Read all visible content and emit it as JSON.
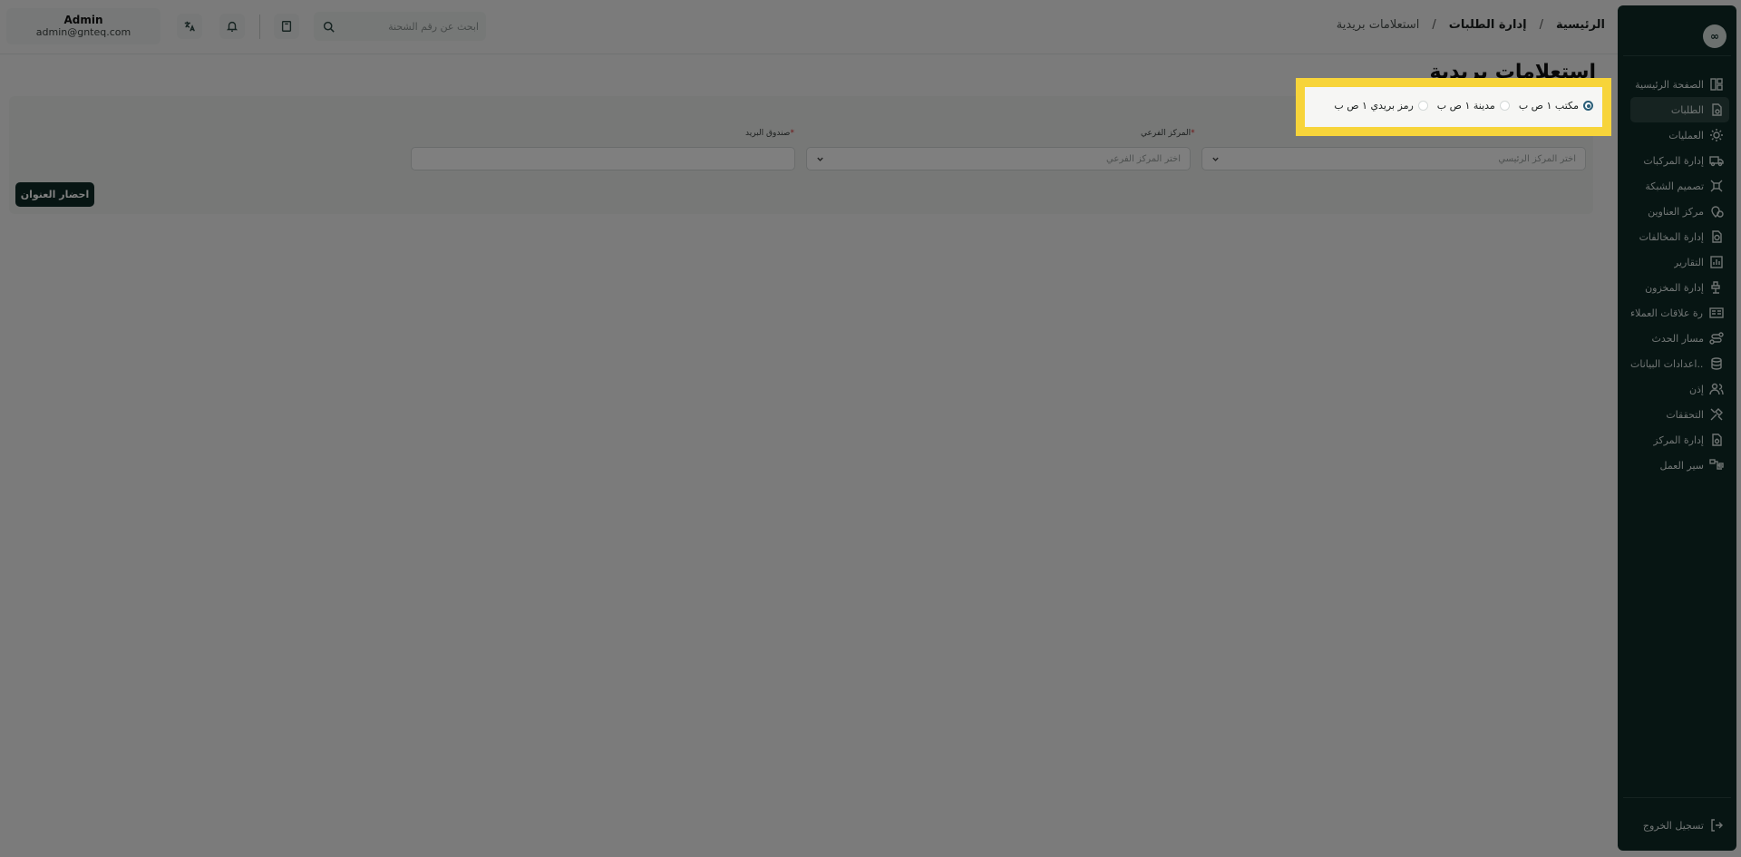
{
  "header": {
    "breadcrumb": [
      "الرئيسية",
      "إدارة الطلبات",
      "استعلامات بريدية"
    ],
    "search_placeholder": "ابحث عن رقم الشحنة",
    "user_name": "Admin",
    "user_email": "admin@gnteq.com"
  },
  "sidebar": {
    "items": [
      {
        "label": "الصفحة الرئيسية",
        "icon": "dashboard-icon"
      },
      {
        "label": "الطلبات",
        "icon": "orders-icon"
      },
      {
        "label": "العمليات",
        "icon": "operations-icon"
      },
      {
        "label": "إدارة المركبات",
        "icon": "truck-icon"
      },
      {
        "label": "تصميم الشبكة",
        "icon": "network-icon"
      },
      {
        "label": "مركز العناوين",
        "icon": "location-icon"
      },
      {
        "label": "إدارة المخالفات",
        "icon": "violation-icon"
      },
      {
        "label": "التقارير",
        "icon": "reports-icon"
      },
      {
        "label": "إدارة المخزون",
        "icon": "inventory-icon"
      },
      {
        "label": "إدارة علاقات العملاء",
        "icon": "crm-icon"
      },
      {
        "label": "مسار الحدث",
        "icon": "route-icon"
      },
      {
        "label": "اعدادات البيانات...",
        "icon": "database-icon"
      },
      {
        "label": "إذن",
        "icon": "users-icon"
      },
      {
        "label": "التحققات",
        "icon": "tools-icon"
      },
      {
        "label": "إدارة المركز",
        "icon": "center-icon"
      },
      {
        "label": "سير العمل",
        "icon": "workflow-icon"
      }
    ],
    "logout_label": "تسجيل الخروج"
  },
  "main": {
    "title": "استعلامات بريدية",
    "radio_options": [
      {
        "label": "مكتب ١ ص ب",
        "selected": true
      },
      {
        "label": "مدينة ١ ص ب",
        "selected": false
      },
      {
        "label": "رمز بريدي ١ ص ب",
        "selected": false
      }
    ],
    "fields": {
      "main_center_placeholder": "اختر المركز الرئيسي",
      "sub_center_label": "المركز الفرعي",
      "sub_center_placeholder": "اختر المركز الفرعي",
      "po_box_label": "صندوق البريد"
    },
    "fetch_button": "احضار العنوان"
  },
  "colors": {
    "sidebar_bg": "#0e2a27",
    "highlight": "#f7d43a",
    "radio_selected": "#2a5e78"
  }
}
